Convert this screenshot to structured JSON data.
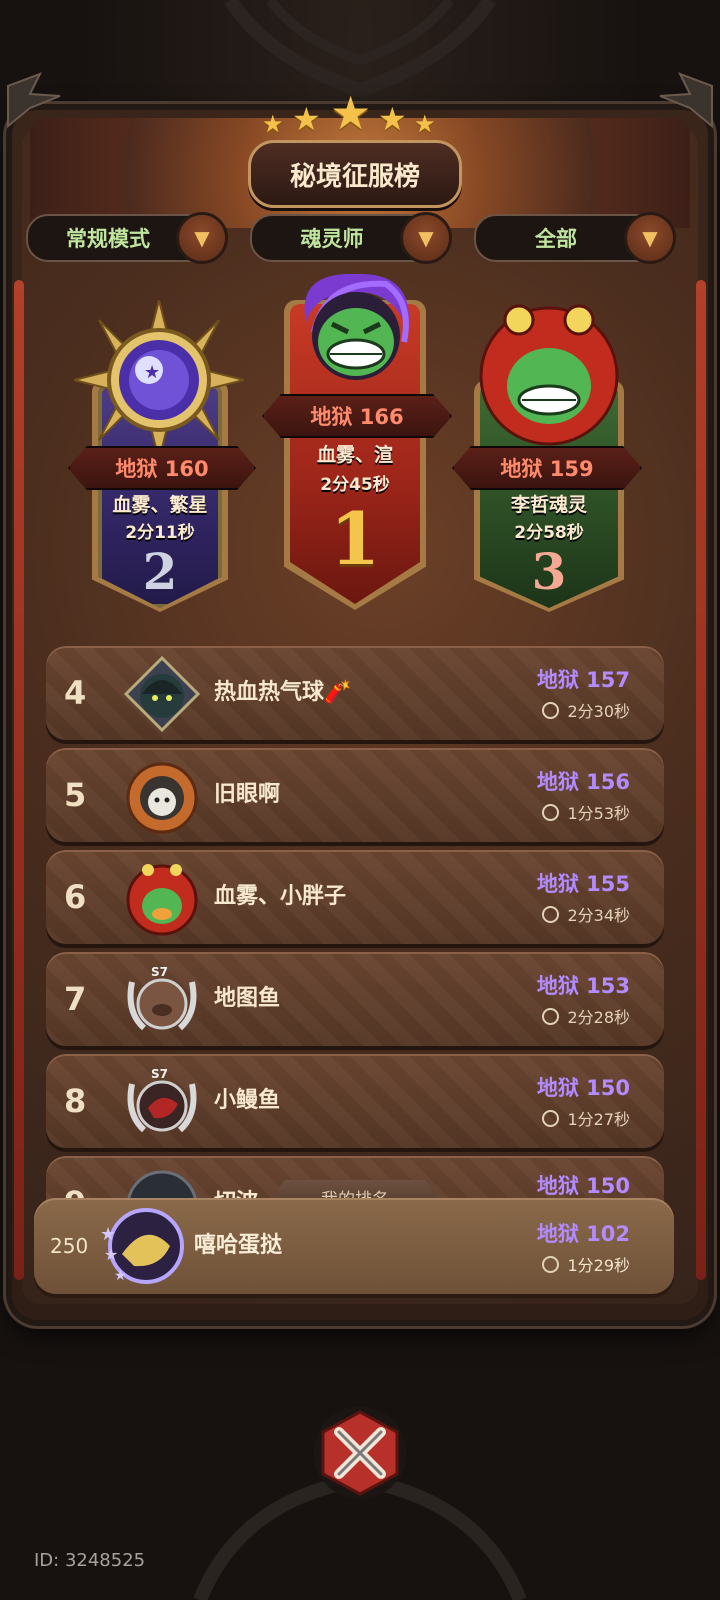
{
  "title": "秘境征服榜",
  "filters": [
    {
      "label": "常规模式"
    },
    {
      "label": "魂灵师"
    },
    {
      "label": "全部"
    }
  ],
  "podium": {
    "first": {
      "rank": "1",
      "score": "地狱 166",
      "name": "血雾、渲",
      "time": "2分45秒"
    },
    "second": {
      "rank": "2",
      "score": "地狱 160",
      "name": "血雾、繁星",
      "time": "2分11秒"
    },
    "third": {
      "rank": "3",
      "score": "地狱 159",
      "name": "李哲魂灵",
      "time": "2分58秒"
    }
  },
  "rows": [
    {
      "rank": "4",
      "name": "热血热气球🧨",
      "score": "地狱 157",
      "time": "2分30秒"
    },
    {
      "rank": "5",
      "name": "旧眼啊",
      "score": "地狱 156",
      "time": "1分53秒"
    },
    {
      "rank": "6",
      "name": "血雾、小胖子",
      "score": "地狱 155",
      "time": "2分34秒"
    },
    {
      "rank": "7",
      "name": "地图鱼",
      "score": "地狱 153",
      "time": "2分28秒",
      "badge": "S7"
    },
    {
      "rank": "8",
      "name": "小鳗鱼",
      "score": "地狱 150",
      "time": "1分27秒",
      "badge": "S7"
    },
    {
      "rank": "9",
      "name": "切波",
      "score": "地狱 150"
    }
  ],
  "my_rank": {
    "tab_label": "我的排名",
    "rank": "250",
    "name": "嘻哈蛋挞",
    "score": "地狱 102",
    "time": "1分29秒"
  },
  "footer": {
    "id_text": "ID: 3248525"
  },
  "colors": {
    "score_purple": "#b38bff",
    "podium_score_red": "#ff8a6c",
    "filter_green": "#bfe59e"
  },
  "icons": {
    "dropdown": "chevron-down-icon",
    "clock": "clock-icon",
    "close": "close-x-icon"
  }
}
